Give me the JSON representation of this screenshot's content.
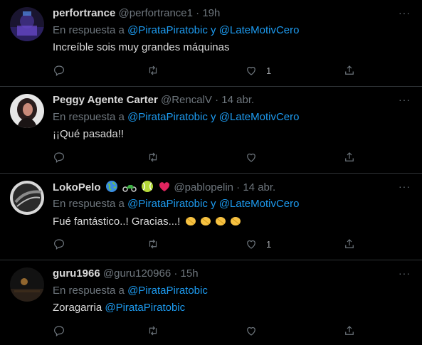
{
  "tweets": [
    {
      "name": "perfortrance",
      "handle": "@perfortrance1",
      "time": "19h",
      "reply_prefix": "En respuesta a",
      "reply_users": [
        "@PirataPiratobic",
        "@LateMotivCero"
      ],
      "reply_join": "y",
      "text": "Increíble sois muy grandes máquinas",
      "like_count": "1",
      "avatar_colors": [
        "#1a1530",
        "#3b2c7a",
        "#6c4bd1"
      ]
    },
    {
      "name": "Peggy Agente Carter",
      "handle": "@RencalV",
      "time": "14 abr.",
      "reply_prefix": "En respuesta a",
      "reply_users": [
        "@PirataPiratobic",
        "@LateMotivCero"
      ],
      "reply_join": "y",
      "text": "¡¡Qué pasada!!",
      "like_count": "",
      "avatar_colors": [
        "#e6e6e6",
        "#2a1d1d",
        "#c98a7a"
      ]
    },
    {
      "name": "LokoPelo",
      "handle": "@pablopelin",
      "time": "14 abr.",
      "reply_prefix": "En respuesta a",
      "reply_users": [
        "@PirataPiratobic",
        "@LateMotivCero"
      ],
      "reply_join": "y",
      "text": "Fué fantástico..!  Gracias...! ",
      "like_count": "1",
      "avatar_colors": [
        "#d8d8d8",
        "#2a2a2a",
        "#8a8a8a"
      ]
    },
    {
      "name": "guru1966",
      "handle": "@guru120966",
      "time": "15h",
      "reply_prefix": "En respuesta a",
      "reply_users": [
        "@PirataPiratobic"
      ],
      "reply_join": "",
      "text_plain": "Zoragarria ",
      "text_mention": "@PirataPiratobic",
      "like_count": "",
      "avatar_colors": [
        "#1a1a1a",
        "#3a2a1a",
        "#c88a3a"
      ]
    }
  ],
  "dot": "·",
  "more": "···",
  "colors": {
    "background": "#000000",
    "text": "#d9d9d9",
    "muted": "#6e767d",
    "link": "#1d9bf0",
    "divider": "#2f3336"
  },
  "icons": [
    "reply-icon",
    "retweet-icon",
    "like-icon",
    "share-icon",
    "more-icon"
  ]
}
